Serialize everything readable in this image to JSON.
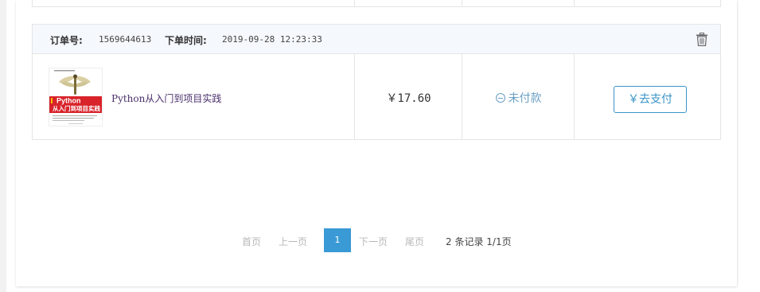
{
  "order": {
    "order_no_label": "订单号:",
    "order_no": "1569644613",
    "order_time_label": "下单时间:",
    "order_time": "2019-09-28 12:23:33",
    "product": {
      "name": "Python从入门到项目实践",
      "cover_title": "Python",
      "cover_subtitle": "从入门到项目实践"
    },
    "price": "￥17.60",
    "status": "未付款",
    "pay_button": "￥去支付"
  },
  "pagination": {
    "first": "首页",
    "prev": "上一页",
    "current": "1",
    "next": "下一页",
    "last": "尾页",
    "info": "2 条记录 1/1页"
  },
  "colors": {
    "accent": "#3a9ad6",
    "status": "#6a9fc4",
    "header_bg": "#f5f8fc",
    "border": "#e5e5e5"
  },
  "icons": {
    "delete": "trash-icon",
    "status": "minus-circle-icon"
  }
}
